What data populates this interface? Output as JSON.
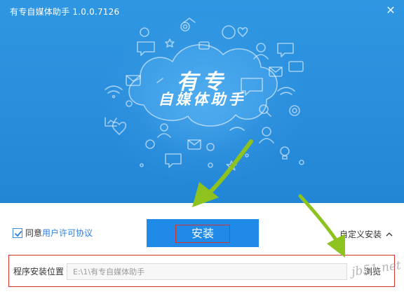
{
  "window": {
    "app_name": "有专自媒体助手",
    "version": "1.0.0.7126",
    "close_glyph": "✕"
  },
  "banner": {
    "brand_line1": "有专",
    "brand_line2": "自媒体助手",
    "bg_color": "#2a8fdd"
  },
  "agreement": {
    "checked": true,
    "prefix": "同意",
    "link_text": "用户许可协议"
  },
  "actions": {
    "install_label": "安装",
    "custom_install_label": "自定义安装",
    "custom_install_chevron": "^"
  },
  "install_path": {
    "label": "程序安装位置",
    "value": "E:\\1\\有专自媒体助手",
    "browse_label": "浏览"
  },
  "watermark": "jb51.net",
  "colors": {
    "accent": "#1f8ae8",
    "highlight_border": "#d9332e",
    "arrow": "#8dc21f",
    "link": "#2b7de0"
  }
}
